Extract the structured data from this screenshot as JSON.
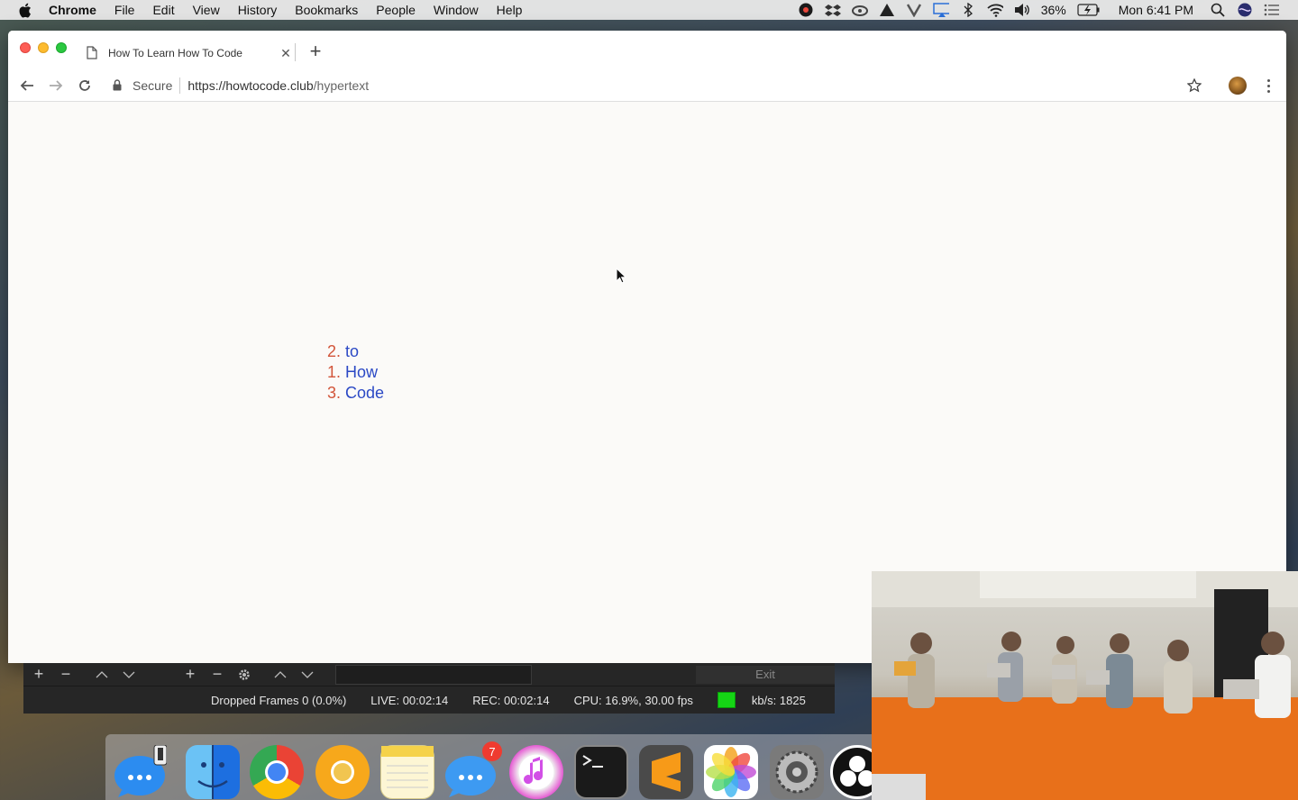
{
  "menubar": {
    "app_name": "Chrome",
    "menus": [
      "File",
      "Edit",
      "View",
      "History",
      "Bookmarks",
      "People",
      "Window",
      "Help"
    ],
    "battery": "36%",
    "clock": "Mon 6:41 PM"
  },
  "browser": {
    "tab_title": "How To Learn How To Code",
    "security_label": "Secure",
    "url_host": "https://howtocode.club",
    "url_path": "/hypertext"
  },
  "page": {
    "list": [
      {
        "num": "2.",
        "word": "to"
      },
      {
        "num": "1.",
        "word": "How"
      },
      {
        "num": "3.",
        "word": "Code"
      }
    ]
  },
  "obs": {
    "exit_label": "Exit",
    "dropped_frames": "Dropped Frames 0 (0.0%)",
    "live": "LIVE: 00:02:14",
    "rec": "REC: 00:02:14",
    "cpu": "CPU: 16.9%, 30.00 fps",
    "bitrate": "kb/s: 1825",
    "status_color": "#15d515"
  },
  "dock": {
    "messages_badge": "7",
    "apps": [
      "messages-remote-icon",
      "finder-icon",
      "chrome-icon",
      "chrome-canary-icon",
      "notes-icon",
      "messages-icon",
      "itunes-icon",
      "terminal-icon",
      "sublime-text-icon",
      "photos-icon",
      "system-preferences-icon",
      "obs-icon"
    ]
  },
  "colors": {
    "list_number": "#d2553a",
    "list_word": "#2b49c5"
  }
}
